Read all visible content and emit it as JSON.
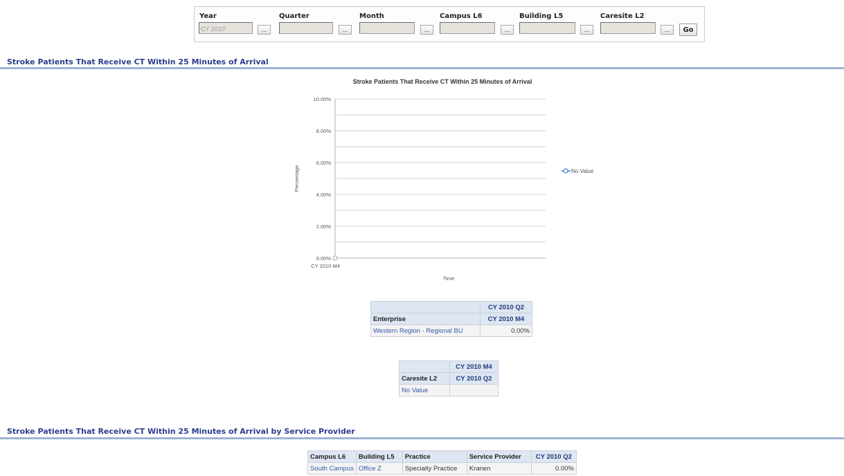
{
  "prompts": {
    "fields": [
      {
        "label": "Year",
        "value": "CY 2010'"
      },
      {
        "label": "Quarter",
        "value": ""
      },
      {
        "label": "Month",
        "value": ""
      },
      {
        "label": "Campus L6",
        "value": ""
      },
      {
        "label": "Building L5",
        "value": ""
      },
      {
        "label": "Caresite L2",
        "value": ""
      }
    ],
    "browse_label": "...",
    "go_label": "Go"
  },
  "section1": {
    "title": "Stroke Patients That Receive CT Within 25 Minutes of Arrival"
  },
  "chart_data": {
    "type": "line",
    "title": "Stroke Patients That Receive CT Within 25 Minutes of Arrival",
    "xlabel": "Time",
    "ylabel": "Percentage",
    "categories": [
      "CY 2010 M4"
    ],
    "series": [
      {
        "name": "No Value",
        "values": [
          0
        ]
      }
    ],
    "ylim": [
      0,
      10
    ],
    "yticks": [
      "10.00%",
      "8.00%",
      "6.00%",
      "4.00%",
      "2.00%",
      "0.00%"
    ],
    "grid": true,
    "legend": "right",
    "colors": {
      "series": "#3a7fd0",
      "grid": "#cfcfcf"
    }
  },
  "pivot1": {
    "col_header_top": "CY 2010 Q2",
    "row_header": "Enterprise",
    "col_header": "CY 2010 M4",
    "row_label": "Western Region - Regional BU",
    "row_value": "0.00%"
  },
  "pivot2": {
    "col_header_top": "CY 2010 M4",
    "row_header": "Caresite L2",
    "col_header": "CY 2010 Q2",
    "row_label": "No Value",
    "row_value": ""
  },
  "section2": {
    "title": "Stroke Patients That Receive CT Within 25 Minutes of Arrival by Service Provider"
  },
  "table3": {
    "headers": [
      "Campus L6",
      "Building L5",
      "Practice",
      "Service Provider",
      "CY 2010 Q2"
    ],
    "rows": [
      [
        "South Campus",
        "Office Z",
        "Specialty Practice",
        "Kranen",
        "0.00%"
      ]
    ]
  }
}
